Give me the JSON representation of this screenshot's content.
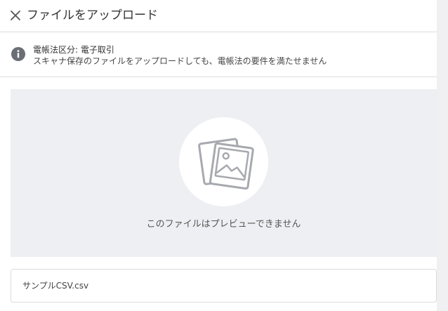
{
  "header": {
    "title": "ファイルをアップロード",
    "close_icon": "close-icon"
  },
  "notice": {
    "icon": "info-icon",
    "line1": "電帳法区分: 電子取引",
    "line2": "スキャナ保存のファイルをアップロードしても、電帳法の要件を満たせません"
  },
  "preview": {
    "icon": "image-placeholder-icon",
    "message": "このファイルはプレビューできません"
  },
  "file": {
    "name": "サンプルCSV.csv"
  },
  "colors": {
    "divider": "#dcdcdc",
    "preview_bg": "#eeeff2",
    "icon_gray": "#a7a9ae",
    "info_icon": "#6b6e75"
  }
}
